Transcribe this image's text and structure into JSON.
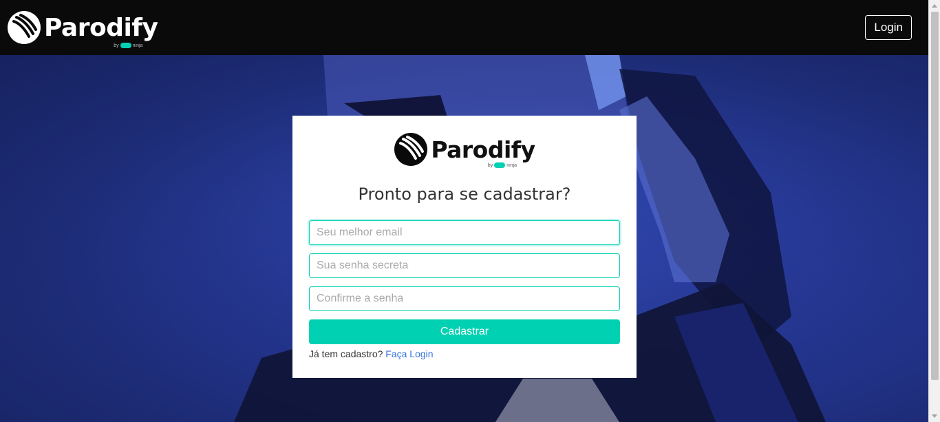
{
  "brand": {
    "name": "Parodify",
    "sub_by": "by",
    "sub_name": "ninja"
  },
  "navbar": {
    "login_label": "Login"
  },
  "signup": {
    "title": "Pronto para se cadastrar?",
    "email_placeholder": "Seu melhor email",
    "password_placeholder": "Sua senha secreta",
    "confirm_placeholder": "Confirme a senha",
    "submit_label": "Cadastrar",
    "have_account_text": "Já tem cadastro?",
    "login_link": "Faça Login"
  },
  "colors": {
    "accent": "#00d1b2",
    "navbar_bg": "#0a0a0a",
    "link": "#3273dc"
  }
}
